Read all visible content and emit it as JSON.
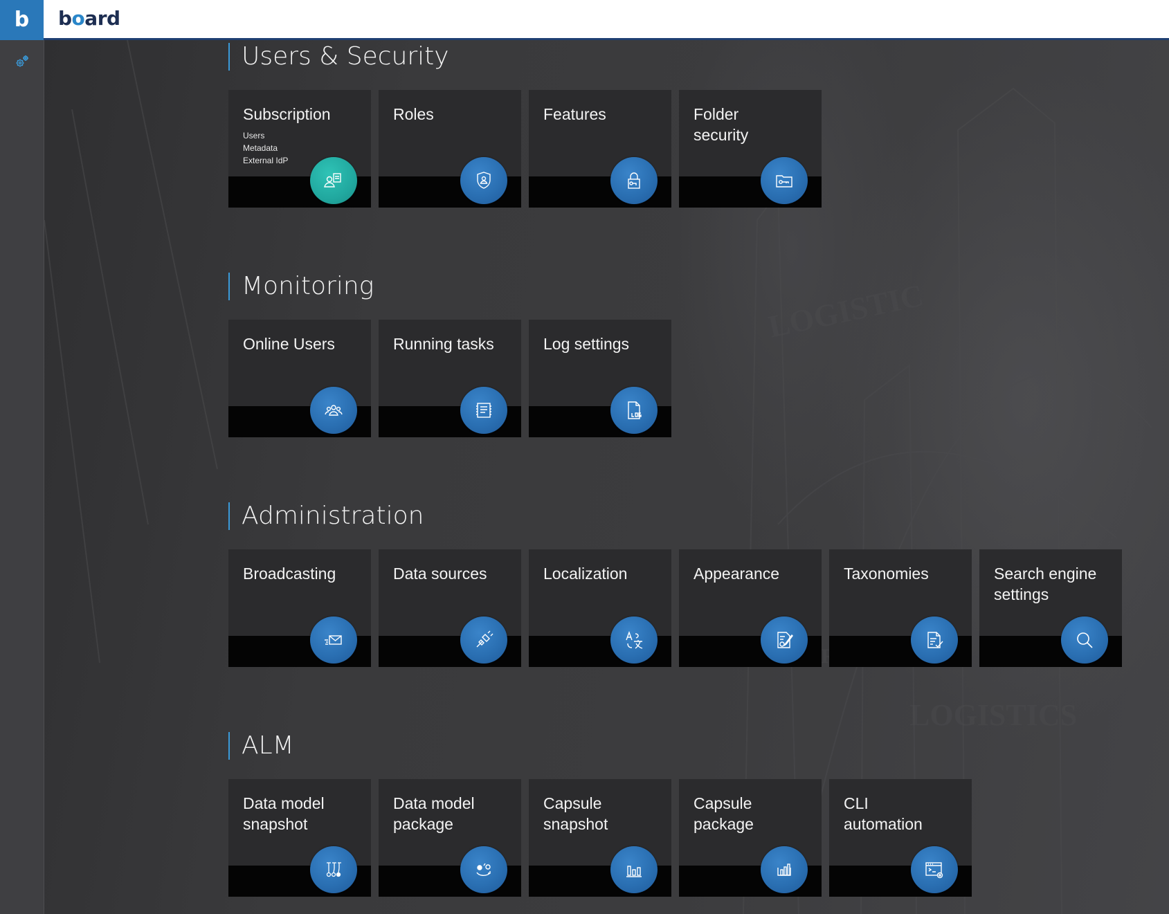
{
  "app": {
    "logo_letter": "b",
    "brand_prefix": "b",
    "brand_o": "o",
    "brand_suffix": "ard",
    "sidebar_icon": "gears-icon"
  },
  "colors": {
    "accent": "#2a78b9",
    "tile_icon_blue": "#2a6fb2",
    "tile_icon_teal": "#21a89f",
    "header_border": "#1f3f72"
  },
  "sections": [
    {
      "title": "Users & Security",
      "tiles": [
        {
          "label": "Subscription",
          "sub": [
            "Users",
            "Metadata",
            "External IdP"
          ],
          "icon": "user-document-icon",
          "variant": "teal"
        },
        {
          "label": "Roles",
          "icon": "shield-user-icon"
        },
        {
          "label": "Features",
          "icon": "padlock-icon"
        },
        {
          "label": "Folder\nsecurity",
          "icon": "folder-key-icon"
        }
      ]
    },
    {
      "title": "Monitoring",
      "tiles": [
        {
          "label": "Online Users",
          "icon": "users-group-icon"
        },
        {
          "label": "Running tasks",
          "icon": "task-chip-icon"
        },
        {
          "label": "Log settings",
          "icon": "log-file-icon"
        }
      ]
    },
    {
      "title": "Administration",
      "tiles": [
        {
          "label": "Broadcasting",
          "icon": "envelope-send-icon"
        },
        {
          "label": "Data sources",
          "icon": "plug-connector-icon"
        },
        {
          "label": "Localization",
          "icon": "translate-icon"
        },
        {
          "label": "Appearance",
          "icon": "palette-document-icon"
        },
        {
          "label": "Taxonomies",
          "icon": "document-check-icon"
        },
        {
          "label": "Search engine\nsettings",
          "icon": "magnifier-icon"
        }
      ]
    },
    {
      "title": "ALM",
      "tiles": [
        {
          "label": "Data model\nsnapshot",
          "icon": "model-snapshot-icon"
        },
        {
          "label": "Data model\npackage",
          "icon": "model-package-icon"
        },
        {
          "label": "Capsule\nsnapshot",
          "icon": "capsule-snapshot-icon"
        },
        {
          "label": "Capsule\npackage",
          "icon": "capsule-package-icon"
        },
        {
          "label": "CLI\nautomation",
          "icon": "terminal-gear-icon"
        }
      ]
    }
  ]
}
